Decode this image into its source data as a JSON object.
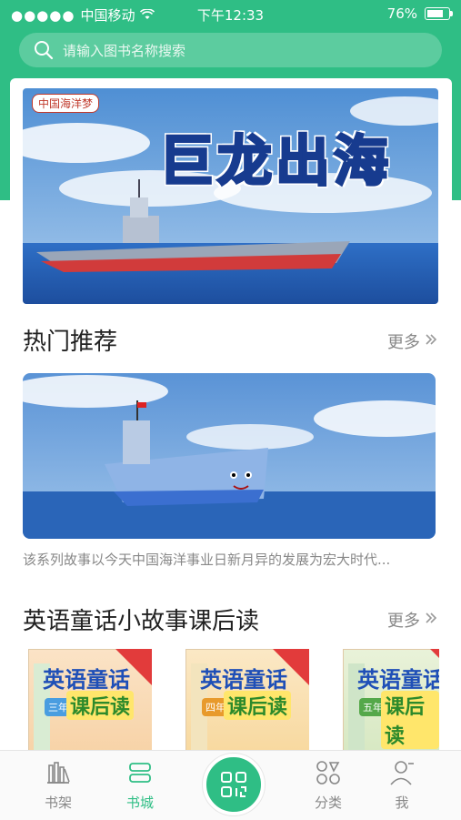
{
  "status_bar": {
    "carrier": "中国移动",
    "time": "下午12:33",
    "battery": "76%",
    "battery_level": 0.76
  },
  "search": {
    "placeholder": "请输入图书名称搜索"
  },
  "banner": {
    "brand": "中国海洋梦",
    "title": "巨龙出海"
  },
  "hot": {
    "title": "热门推荐",
    "more": "更多",
    "description": "该系列故事以今天中国海洋事业日新月异的发展为宏大时代..."
  },
  "english": {
    "title": "英语童话小故事课后读",
    "more": "更多",
    "books": [
      {
        "title": "英语童话",
        "subtitle": "课后读",
        "grade": "三年级"
      },
      {
        "title": "英语童话",
        "subtitle": "课后读",
        "grade": "四年级"
      },
      {
        "title": "英语童话",
        "subtitle": "课后读",
        "grade": "五年级"
      }
    ]
  },
  "tabbar": {
    "items": [
      {
        "label": "书架",
        "icon": "bookshelf-icon",
        "active": false
      },
      {
        "label": "书城",
        "icon": "bookstore-icon",
        "active": true
      },
      {
        "label": "",
        "icon": "scan-icon",
        "active": false
      },
      {
        "label": "分类",
        "icon": "category-icon",
        "active": false
      },
      {
        "label": "我",
        "icon": "profile-icon",
        "active": false
      }
    ]
  },
  "colors": {
    "brand": "#2fbe85",
    "tab_active": "#2fbe85",
    "tab_inactive": "#888888"
  }
}
